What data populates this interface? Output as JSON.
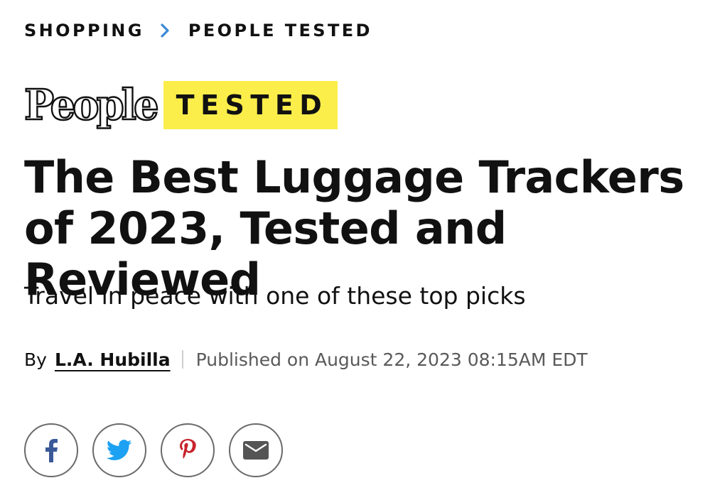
{
  "breadcrumb": {
    "items": [
      {
        "label": "SHOPPING"
      },
      {
        "label": "PEOPLE TESTED"
      }
    ],
    "separator_icon": "chevron-right-icon",
    "separator_color": "#3a8ad6"
  },
  "brand": {
    "logo_text": "People",
    "badge_text": "TESTED",
    "badge_color": "#fcee4a"
  },
  "article": {
    "title": "The Best Luggage Trackers of 2023, Tested and Reviewed",
    "subtitle": "Travel in peace with one of these top picks",
    "byline_prefix": "By",
    "author": "L.A. Hubilla",
    "published": "Published on August 22, 2023 08:15AM EDT"
  },
  "share": {
    "buttons": [
      {
        "icon": "facebook-icon",
        "color": "#3b5998"
      },
      {
        "icon": "twitter-icon",
        "color": "#1da1f2"
      },
      {
        "icon": "pinterest-icon",
        "color": "#c8232c"
      },
      {
        "icon": "email-icon",
        "color": "#555555"
      }
    ]
  }
}
